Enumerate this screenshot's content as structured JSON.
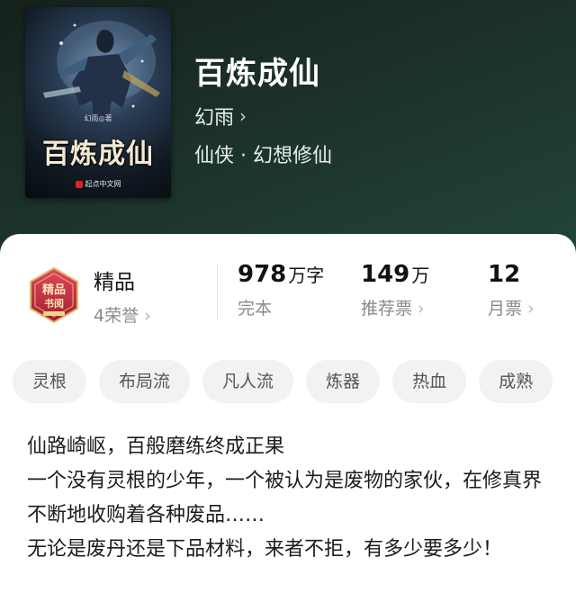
{
  "book": {
    "title": "百炼成仙",
    "author": "幻雨",
    "genre": "仙侠 · 幻想修仙",
    "cover": {
      "title": "百炼成仙",
      "author": "幻雨◎著",
      "publisher": "起点中文网"
    }
  },
  "stats": {
    "quality_label": "精品",
    "honors": "4荣誉",
    "word_count": "978",
    "word_unit": "万字",
    "status": "完本",
    "recommend_count": "149",
    "recommend_unit": "万",
    "recommend_label": "推荐票",
    "monthly_count": "12",
    "monthly_label": "月票",
    "badge_text_top": "精品",
    "badge_text_bottom": "书阅"
  },
  "tags": [
    "灵根",
    "布局流",
    "凡人流",
    "炼器",
    "热血",
    "成熟"
  ],
  "description": "仙路崎岖，百般磨练终成正果\n一个没有灵根的少年，一个被认为是废物的家伙，在修真界不断地收购着各种废品……\n无论是废丹还是下品材料，来者不拒，有多少要多少！",
  "colors": {
    "header_bg": "#1f3a31",
    "card_bg": "#ffffff",
    "tag_bg": "#f2f2f2",
    "badge_red": "#c8243a",
    "badge_gold": "#e2b96a"
  }
}
